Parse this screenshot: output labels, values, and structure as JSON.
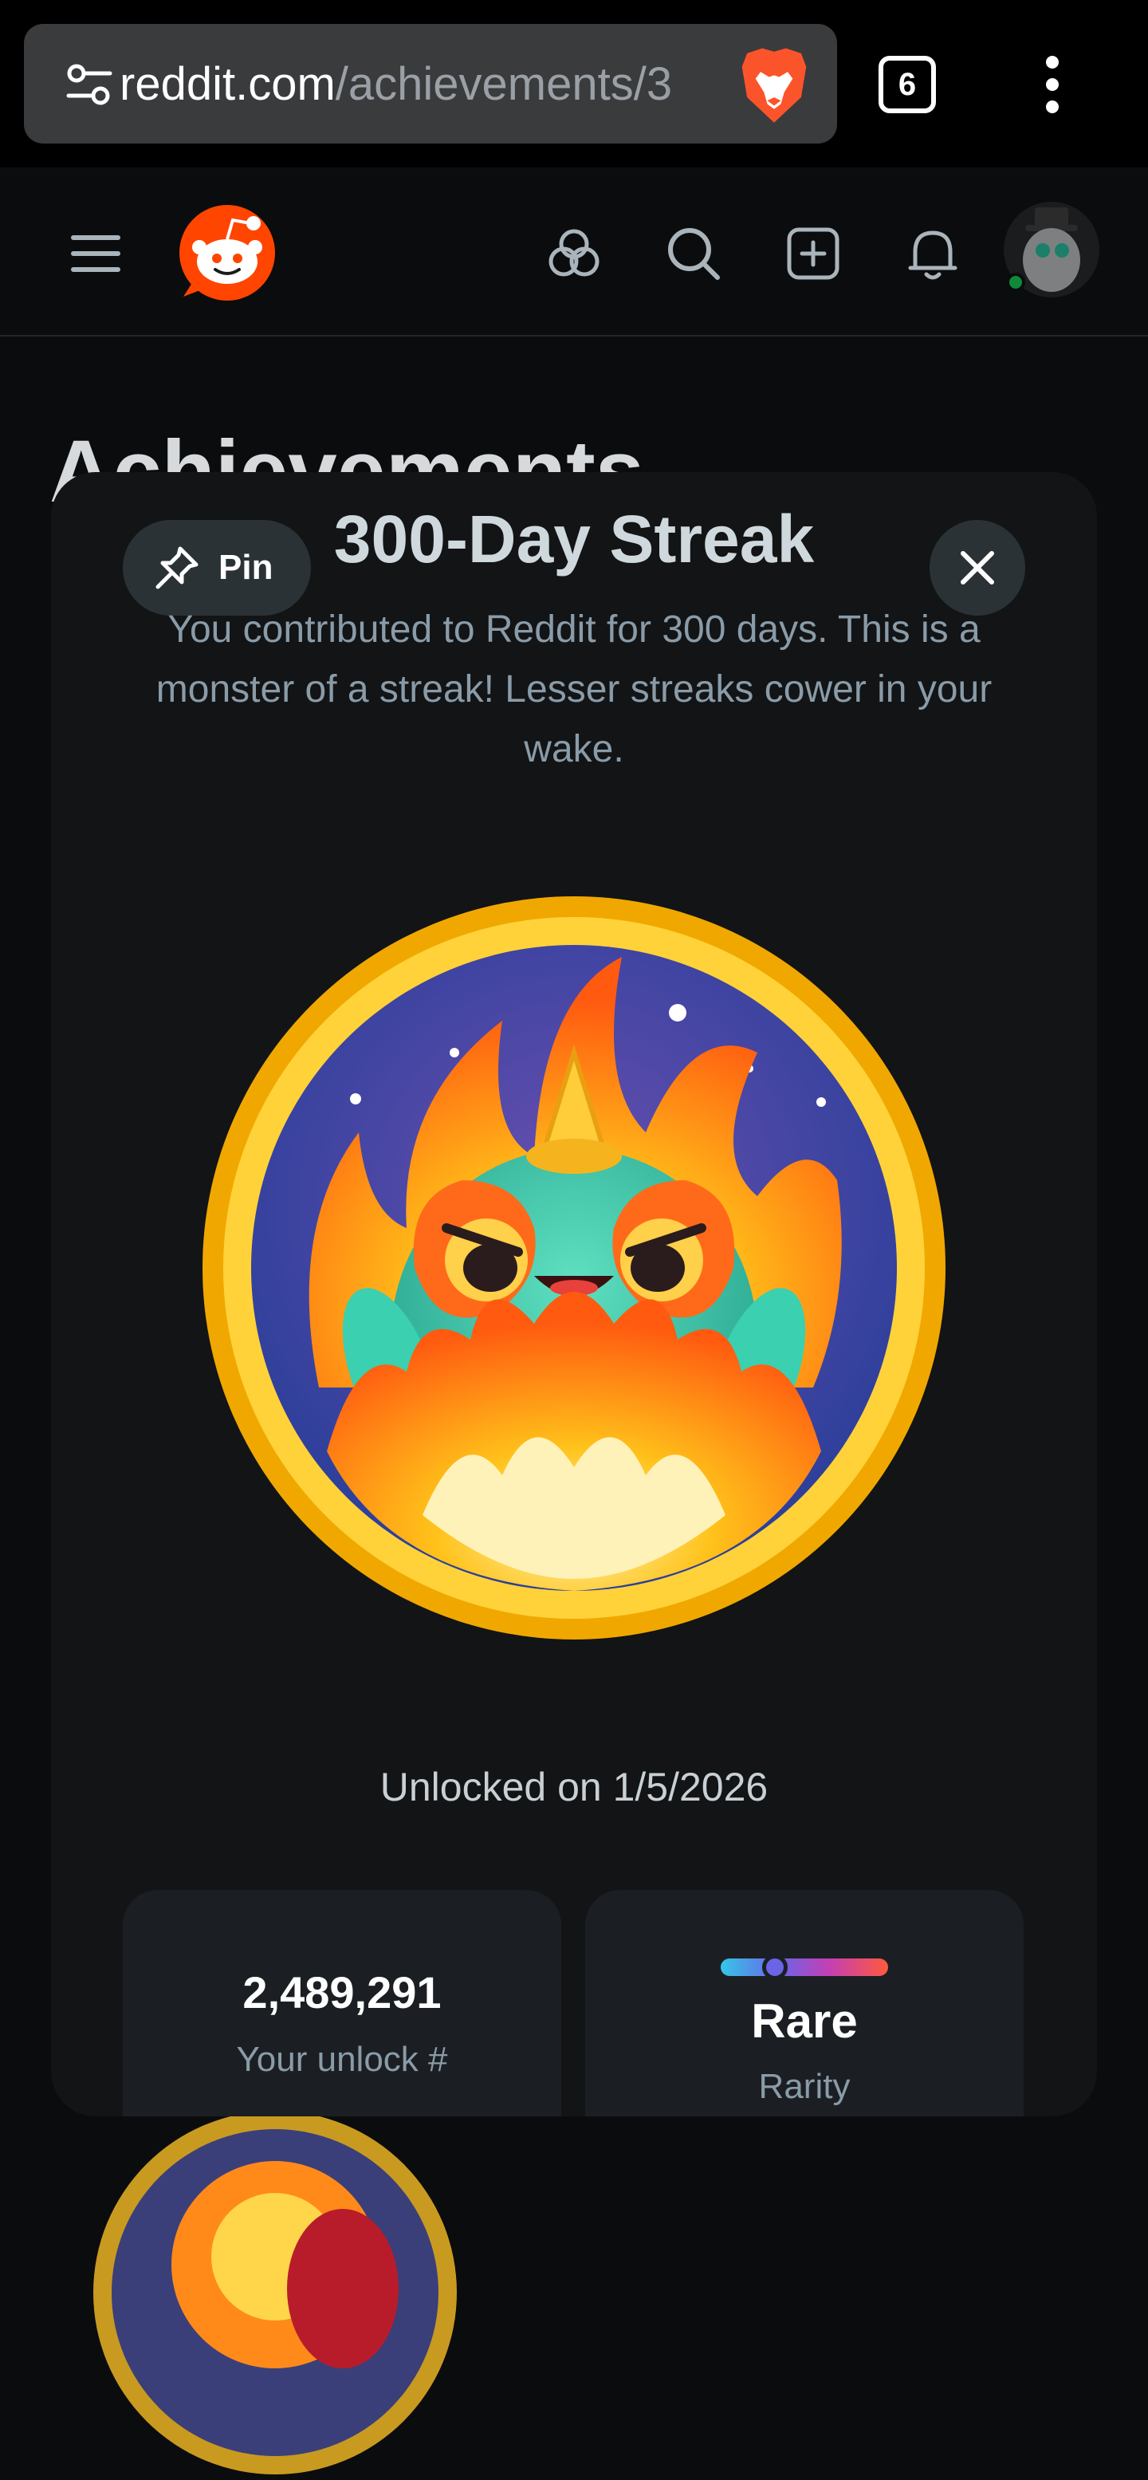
{
  "browser": {
    "url_domain": "reddit.com",
    "url_path": "/achievements/3",
    "tab_count": "6"
  },
  "page": {
    "background_title": "Achievements"
  },
  "modal": {
    "pin_label": "Pin",
    "title": "300-Day Streak",
    "description": "You contributed to Reddit for 300 days. This is a monster of a streak! Lesser streaks cower in your wake.",
    "unlocked_text": "Unlocked on 1/5/2026",
    "stats": [
      {
        "value": "2,489,291",
        "label": "Your unlock #"
      },
      {
        "value": "Rare",
        "label": "Rarity"
      }
    ]
  },
  "colors": {
    "reddit_orange": "#ff4500",
    "modal_bg": "#121416",
    "card_bg": "#1b1f23",
    "badge_ring": "#f7b500"
  },
  "icons": [
    "site-settings-icon",
    "brave-lion-icon",
    "more-vert-icon",
    "hamburger-menu-icon",
    "reddit-logo-icon",
    "communities-icon",
    "search-icon",
    "create-post-icon",
    "notifications-bell-icon",
    "user-avatar",
    "pin-icon",
    "close-icon"
  ]
}
